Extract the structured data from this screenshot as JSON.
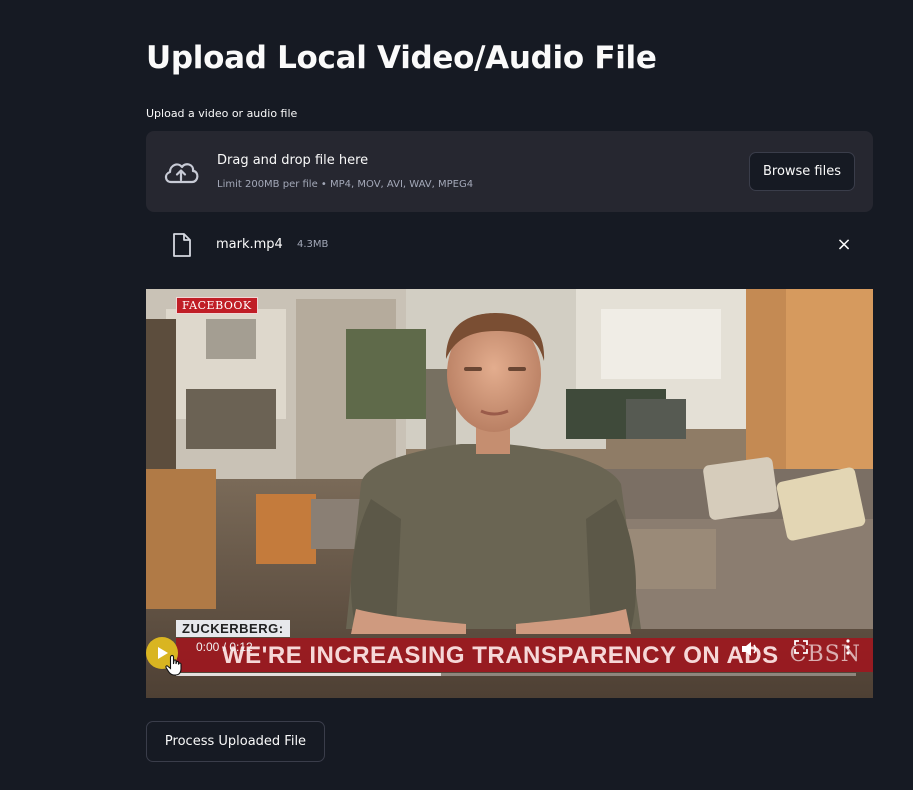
{
  "page": {
    "title": "Upload Local Video/Audio File"
  },
  "uploader": {
    "label": "Upload a video or audio file",
    "drag_text": "Drag and drop file here",
    "limit_text": "Limit 200MB per file • MP4, MOV, AVI, WAV, MPEG4",
    "browse_label": "Browse files",
    "icon": "cloud-upload-icon"
  },
  "uploaded_file": {
    "name": "mark.mp4",
    "size": "4.3MB",
    "icon": "file-icon",
    "remove_symbol": "×"
  },
  "video": {
    "brand_tag": "FACEBOOK",
    "lower_third_name": "ZUCKERBERG:",
    "headline": "WE'RE INCREASING TRANSPARENCY ON ADS",
    "network_logo": "CBSN",
    "player": {
      "time_display": "0:00 / 0:12",
      "progress": 0,
      "buffered": 0.39,
      "controls": [
        "play-icon",
        "volume-icon",
        "fullscreen-icon",
        "more-options-icon"
      ]
    }
  },
  "actions": {
    "process_label": "Process Uploaded File"
  },
  "colors": {
    "background": "#161a23",
    "panel": "#262730",
    "text": "#fafafa",
    "muted_text": "#a3a8b8",
    "banner_red": "#a0161e",
    "play_button": "#d9b521"
  }
}
